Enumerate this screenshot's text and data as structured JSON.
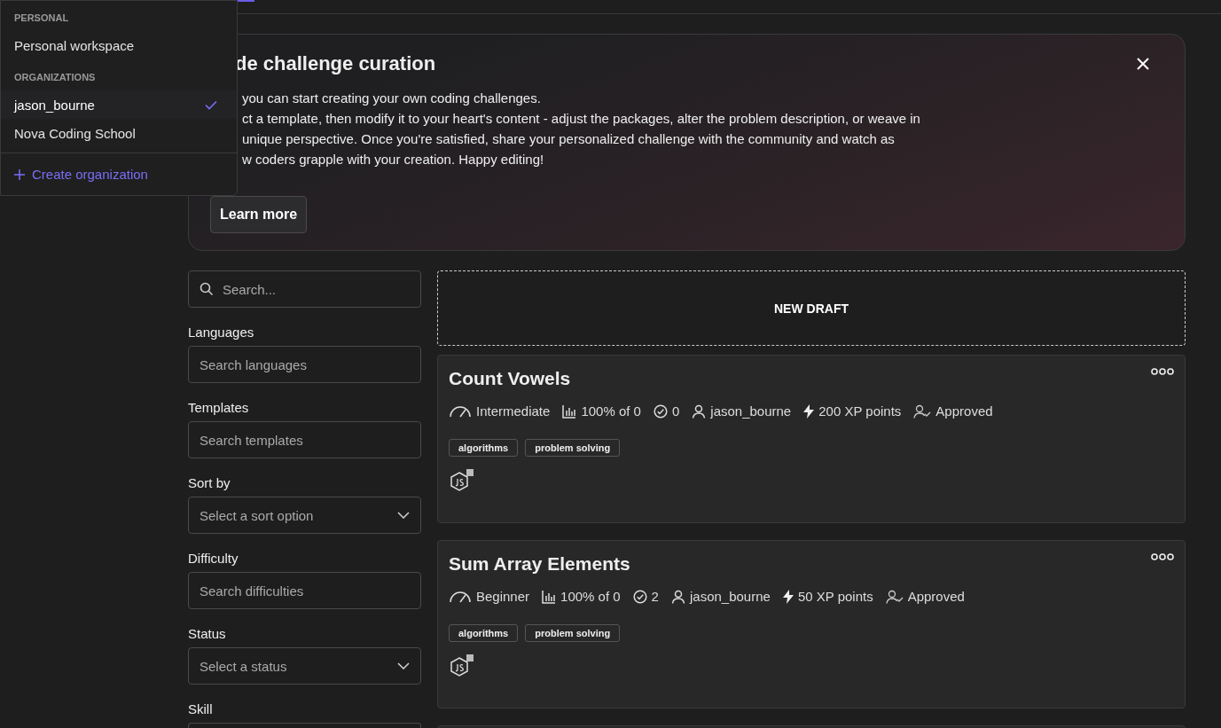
{
  "workspace_menu": {
    "sections": [
      {
        "heading": "PERSONAL",
        "items": [
          {
            "label": "Personal workspace",
            "selected": false
          }
        ]
      },
      {
        "heading": "ORGANIZATIONS",
        "items": [
          {
            "label": "jason_bourne",
            "selected": true
          },
          {
            "label": "Nova Coding School",
            "selected": false
          }
        ]
      }
    ],
    "create_link": "Create organization"
  },
  "banner": {
    "title": "de challenge curation",
    "lines": [
      "you can start creating your own coding challenges.",
      "ct a template, then modify it to your heart's content - adjust the packages, alter the problem description, or weave in",
      "unique perspective. Once you're satisfied, share your personalized challenge with the community and watch as",
      "w coders grapple with your creation. Happy editing!"
    ],
    "button": "Learn more"
  },
  "filters": {
    "search": {
      "placeholder": "Search..."
    },
    "fields": [
      {
        "label": "Languages",
        "kind": "text",
        "placeholder": "Search languages"
      },
      {
        "label": "Templates",
        "kind": "text",
        "placeholder": "Search templates"
      },
      {
        "label": "Sort by",
        "kind": "select",
        "placeholder": "Select a sort option"
      },
      {
        "label": "Difficulty",
        "kind": "text",
        "placeholder": "Search difficulties"
      },
      {
        "label": "Status",
        "kind": "select",
        "placeholder": "Select a status"
      },
      {
        "label": "Skill",
        "kind": "cut"
      }
    ]
  },
  "new_draft": "NEW DRAFT",
  "challenges": [
    {
      "title": "Count Vowels",
      "meta": [
        {
          "kind": "difficulty",
          "text": "Intermediate"
        },
        {
          "kind": "rate",
          "text": "100% of 0"
        },
        {
          "kind": "solved",
          "text": "0"
        },
        {
          "kind": "author",
          "text": "jason_bourne"
        },
        {
          "kind": "xp",
          "text": "200 XP points"
        },
        {
          "kind": "status",
          "text": "Approved"
        }
      ],
      "tags": [
        "algorithms",
        "problem solving"
      ]
    },
    {
      "title": "Sum Array Elements",
      "meta": [
        {
          "kind": "difficulty",
          "text": "Beginner"
        },
        {
          "kind": "rate",
          "text": "100% of 0"
        },
        {
          "kind": "solved",
          "text": "2"
        },
        {
          "kind": "author",
          "text": "jason_bourne"
        },
        {
          "kind": "xp",
          "text": "50 XP points"
        },
        {
          "kind": "status",
          "text": "Approved"
        }
      ],
      "tags": [
        "algorithms",
        "problem solving"
      ]
    }
  ]
}
